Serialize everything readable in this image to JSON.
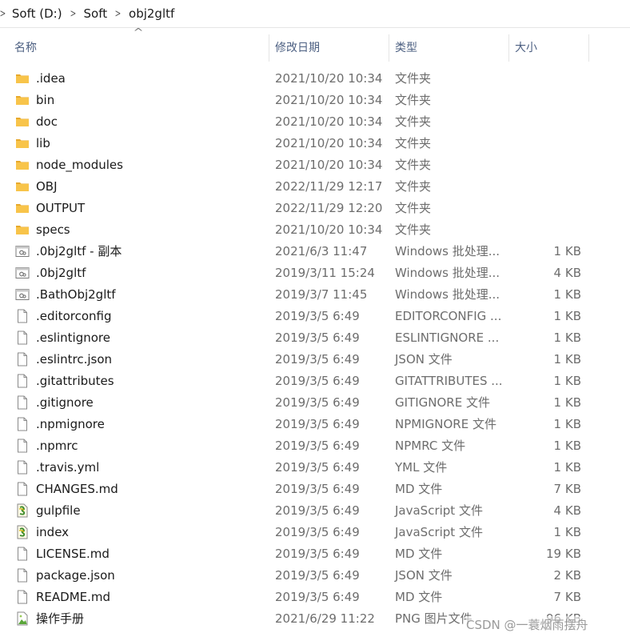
{
  "breadcrumb": {
    "items": [
      "Soft (D:)",
      "Soft",
      "obj2gltf"
    ]
  },
  "columns": {
    "name": "名称",
    "date": "修改日期",
    "type": "类型",
    "size": "大小"
  },
  "files": [
    {
      "name": ".idea",
      "date": "2021/10/20 10:34",
      "type": "文件夹",
      "size": "",
      "icon": "folder-icon"
    },
    {
      "name": "bin",
      "date": "2021/10/20 10:34",
      "type": "文件夹",
      "size": "",
      "icon": "folder-icon"
    },
    {
      "name": "doc",
      "date": "2021/10/20 10:34",
      "type": "文件夹",
      "size": "",
      "icon": "folder-icon"
    },
    {
      "name": "lib",
      "date": "2021/10/20 10:34",
      "type": "文件夹",
      "size": "",
      "icon": "folder-icon"
    },
    {
      "name": "node_modules",
      "date": "2021/10/20 10:34",
      "type": "文件夹",
      "size": "",
      "icon": "folder-icon"
    },
    {
      "name": "OBJ",
      "date": "2022/11/29 12:17",
      "type": "文件夹",
      "size": "",
      "icon": "folder-icon"
    },
    {
      "name": "OUTPUT",
      "date": "2022/11/29 12:20",
      "type": "文件夹",
      "size": "",
      "icon": "folder-icon"
    },
    {
      "name": "specs",
      "date": "2021/10/20 10:34",
      "type": "文件夹",
      "size": "",
      "icon": "folder-icon"
    },
    {
      "name": ".0bj2gltf - 副本",
      "date": "2021/6/3 11:47",
      "type": "Windows 批处理...",
      "size": "1 KB",
      "icon": "batch-file-icon"
    },
    {
      "name": ".0bj2gltf",
      "date": "2019/3/11 15:24",
      "type": "Windows 批处理...",
      "size": "4 KB",
      "icon": "batch-file-icon"
    },
    {
      "name": ".BathObj2gltf",
      "date": "2019/3/7 11:45",
      "type": "Windows 批处理...",
      "size": "1 KB",
      "icon": "batch-file-icon"
    },
    {
      "name": ".editorconfig",
      "date": "2019/3/5 6:49",
      "type": "EDITORCONFIG ...",
      "size": "1 KB",
      "icon": "file-icon"
    },
    {
      "name": ".eslintignore",
      "date": "2019/3/5 6:49",
      "type": "ESLINTIGNORE ...",
      "size": "1 KB",
      "icon": "file-icon"
    },
    {
      "name": ".eslintrc.json",
      "date": "2019/3/5 6:49",
      "type": "JSON 文件",
      "size": "1 KB",
      "icon": "file-icon"
    },
    {
      "name": ".gitattributes",
      "date": "2019/3/5 6:49",
      "type": "GITATTRIBUTES ...",
      "size": "1 KB",
      "icon": "file-icon"
    },
    {
      "name": ".gitignore",
      "date": "2019/3/5 6:49",
      "type": "GITIGNORE 文件",
      "size": "1 KB",
      "icon": "file-icon"
    },
    {
      "name": ".npmignore",
      "date": "2019/3/5 6:49",
      "type": "NPMIGNORE 文件",
      "size": "1 KB",
      "icon": "file-icon"
    },
    {
      "name": ".npmrc",
      "date": "2019/3/5 6:49",
      "type": "NPMRC 文件",
      "size": "1 KB",
      "icon": "file-icon"
    },
    {
      "name": ".travis.yml",
      "date": "2019/3/5 6:49",
      "type": "YML 文件",
      "size": "1 KB",
      "icon": "file-icon"
    },
    {
      "name": "CHANGES.md",
      "date": "2019/3/5 6:49",
      "type": "MD 文件",
      "size": "7 KB",
      "icon": "file-icon"
    },
    {
      "name": "gulpfile",
      "date": "2019/3/5 6:49",
      "type": "JavaScript 文件",
      "size": "4 KB",
      "icon": "javascript-file-icon"
    },
    {
      "name": "index",
      "date": "2019/3/5 6:49",
      "type": "JavaScript 文件",
      "size": "1 KB",
      "icon": "javascript-file-icon"
    },
    {
      "name": "LICENSE.md",
      "date": "2019/3/5 6:49",
      "type": "MD 文件",
      "size": "19 KB",
      "icon": "file-icon"
    },
    {
      "name": "package.json",
      "date": "2019/3/5 6:49",
      "type": "JSON 文件",
      "size": "2 KB",
      "icon": "file-icon"
    },
    {
      "name": "README.md",
      "date": "2019/3/5 6:49",
      "type": "MD 文件",
      "size": "7 KB",
      "icon": "file-icon"
    },
    {
      "name": "操作手册",
      "date": "2021/6/29 11:22",
      "type": "PNG 图片文件",
      "size": "96 KB",
      "icon": "image-file-icon"
    }
  ],
  "watermark": "CSDN @一蓑烟雨摆舟",
  "colors": {
    "folder": "#f8c44a",
    "header_text": "#4d6082",
    "secondary_text": "#6d6d6d",
    "separator": "#e5e5e5"
  }
}
